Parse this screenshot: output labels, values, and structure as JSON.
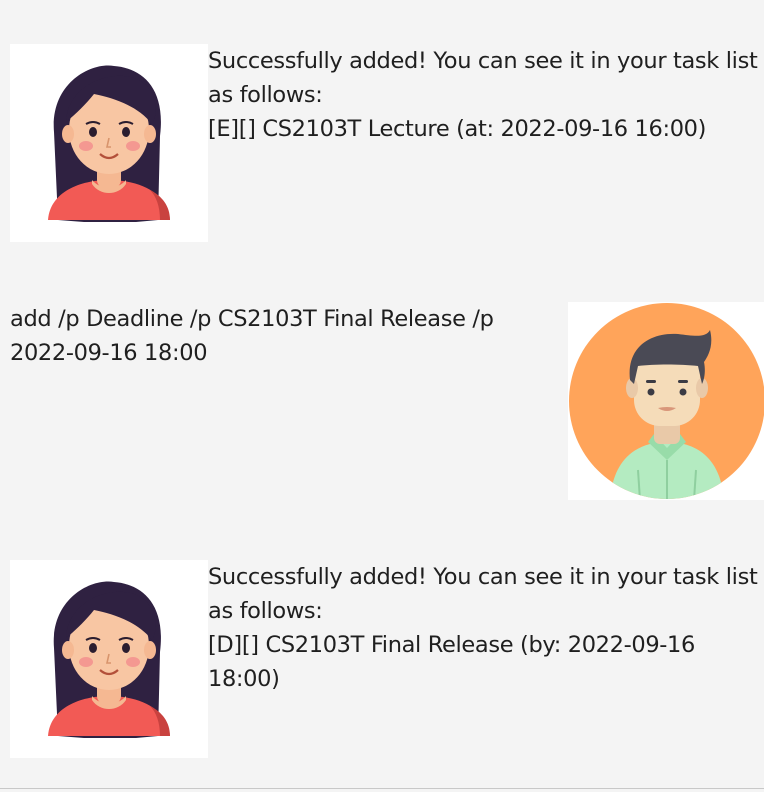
{
  "messages": [
    {
      "sender": "bot",
      "avatar_icon": "woman-avatar-icon",
      "text": "Successfully added! You can see it in your task list\nas follows:\n[E][] CS2103T Lecture (at: 2022-09-16 16:00)"
    },
    {
      "sender": "user",
      "avatar_icon": "man-avatar-icon",
      "text": "add /p Deadline /p CS2103T Final Release /p\n2022-09-16 18:00"
    },
    {
      "sender": "bot",
      "avatar_icon": "woman-avatar-icon",
      "text": "Successfully added! You can see it in your task list\nas follows:\n[D][] CS2103T Final Release (by: 2022-09-16\n18:00)"
    }
  ],
  "colors": {
    "background": "#f4f4f4",
    "bot_shirt": "#f25a55",
    "bot_hair": "#2f2141",
    "user_circle": "#ffa45a",
    "user_shirt": "#b4ebc1",
    "user_hair": "#4a4a55"
  }
}
